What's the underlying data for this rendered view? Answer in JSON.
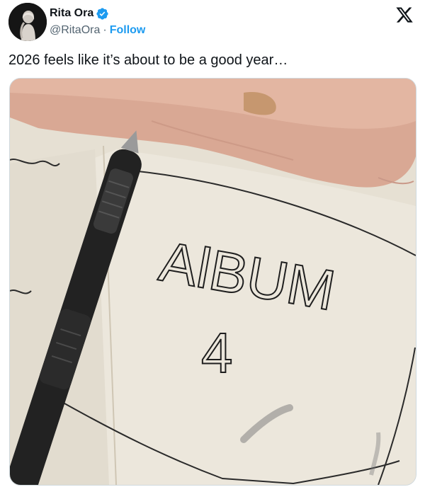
{
  "author": {
    "display_name": "Rita Ora",
    "handle": "@RitaOra",
    "separator": "·",
    "follow_label": "Follow",
    "verified_icon": "verified-badge-icon",
    "verified_color": "#1d9bf0"
  },
  "platform": {
    "logo_icon": "x-logo-icon"
  },
  "tweet": {
    "text": "2026 feels like it’s about to be a good year…"
  },
  "media": {
    "handwriting": {
      "line1": "AlBUM",
      "line2": "4"
    }
  },
  "colors": {
    "link": "#1d9bf0",
    "secondary_text": "#536471",
    "primary_text": "#0f1419"
  }
}
